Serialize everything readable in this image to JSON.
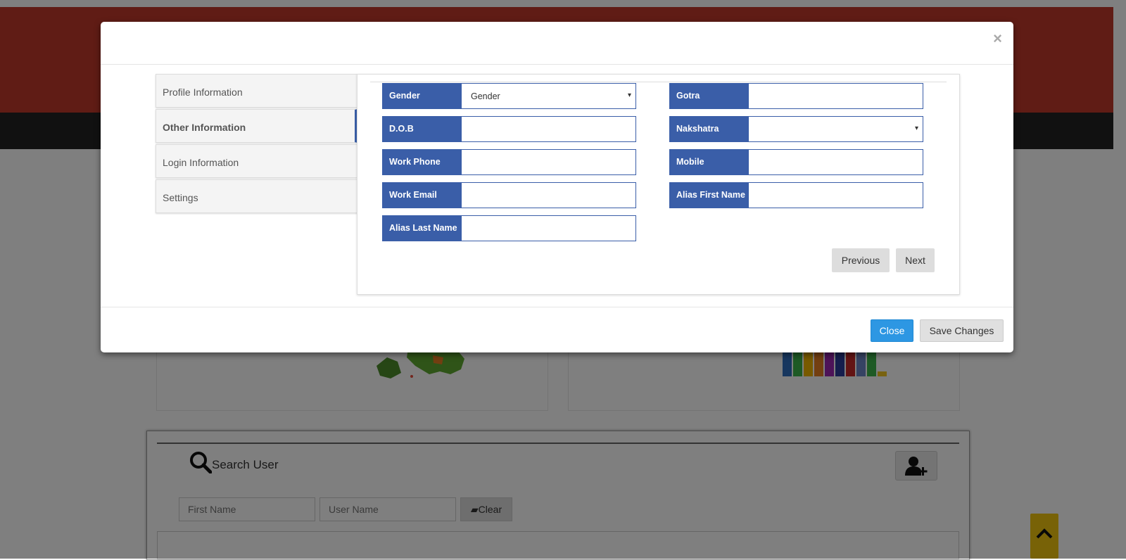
{
  "modal": {
    "close_symbol": "×",
    "side_tabs": [
      {
        "label": "Profile Information"
      },
      {
        "label": "Other Information",
        "active": true
      },
      {
        "label": "Login Information"
      },
      {
        "label": "Settings"
      }
    ],
    "fields": {
      "gender": {
        "label": "Gender",
        "value": "Gender"
      },
      "gotra": {
        "label": "Gotra",
        "value": ""
      },
      "dob": {
        "label": "D.O.B",
        "value": ""
      },
      "nakshatra": {
        "label": "Nakshatra",
        "value": ""
      },
      "work_phone": {
        "label": "Work Phone",
        "value": ""
      },
      "mobile": {
        "label": "Mobile",
        "value": ""
      },
      "work_email": {
        "label": "Work Email",
        "value": ""
      },
      "alias_first_name": {
        "label": "Alias First Name",
        "value": ""
      },
      "alias_last_name": {
        "label": "Alias Last Name",
        "value": ""
      }
    },
    "previous_label": "Previous",
    "next_label": "Next",
    "footer": {
      "close_label": "Close",
      "save_label": "Save Changes"
    },
    "dropdown_caret": "▾"
  },
  "background": {
    "search_title": "Search User",
    "first_name_placeholder": "First Name",
    "user_name_placeholder": "User Name",
    "clear_label": "Clear"
  },
  "colors": {
    "label_bg": "#3a5ea8",
    "close_btn": "#2d97e3",
    "top_bar": "#c0392b",
    "nav_bar": "#222222",
    "scroll_btn": "#f1c40f"
  },
  "icons": [
    "search-icon",
    "add-user-icon",
    "eraser-icon",
    "chevron-up-icon",
    "close-icon",
    "dropdown-caret-icon"
  ]
}
